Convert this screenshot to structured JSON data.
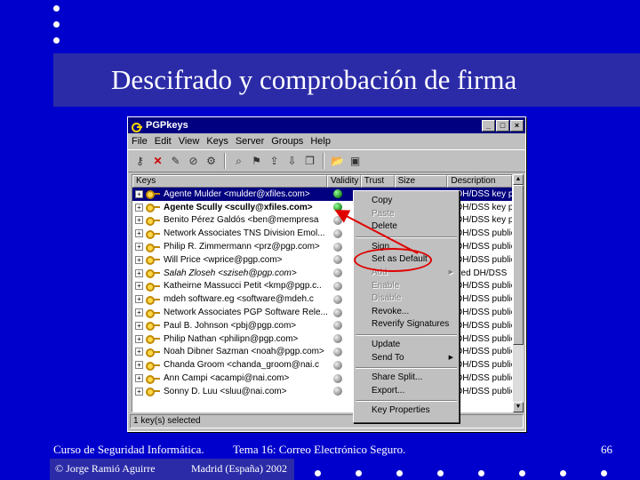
{
  "slide": {
    "title": "Descifrado y comprobación de firma",
    "footer_course": "Curso de Seguridad Informática.",
    "footer_topic": "Tema 16:  Correo Electrónico Seguro.",
    "page_number": "66",
    "author": "© Jorge Ramió Aguirre",
    "location": "Madrid (España) 2002"
  },
  "window": {
    "title": "PGPkeys",
    "menu": [
      "File",
      "Edit",
      "View",
      "Keys",
      "Server",
      "Groups",
      "Help"
    ],
    "columns": [
      "Keys",
      "Validity",
      "Trust",
      "Size",
      "Description"
    ],
    "status": "1 key(s) selected"
  },
  "keys": [
    {
      "name": "Agente Mulder <mulder@xfiles.com>",
      "desc": "DH/DSS key p",
      "validity": "green",
      "style": "sel"
    },
    {
      "name": "Agente Scully <scully@xfiles.com>",
      "desc": "DH/DSS key p",
      "validity": "green",
      "style": "bold"
    },
    {
      "name": "Benito Pérez Galdós <ben@mempresa",
      "desc": "DH/DSS key p",
      "validity": "gray",
      "style": ""
    },
    {
      "name": "Network Associates TNS Division Emol...",
      "desc": "DH/DSS public",
      "validity": "gray",
      "style": ""
    },
    {
      "name": "Philip R. Zimmermann <prz@pgp.com>",
      "desc": "DH/DSS public",
      "validity": "gray",
      "style": ""
    },
    {
      "name": "Will Price <wprice@pgp.com>",
      "desc": "DH/DSS public",
      "validity": "gray",
      "style": ""
    },
    {
      "name": "Salah Zloseh <sziseh@pgp.com>",
      "desc": "ired DH/DSS",
      "validity": "gray",
      "style": "ital"
    },
    {
      "name": "Katheirne Massucci Petit <kmp@pgp.c..",
      "desc": "DH/DSS public",
      "validity": "gray",
      "style": ""
    },
    {
      "name": "mdeh software.eg <software@mdeh.c",
      "desc": "DH/DSS public",
      "validity": "gray",
      "style": ""
    },
    {
      "name": "Network Associates PGP Software Rele...",
      "desc": "DH/DSS public",
      "validity": "gray",
      "style": ""
    },
    {
      "name": "Paul B. Johnson <pbj@pgp.com>",
      "desc": "DH/DSS public",
      "validity": "gray",
      "style": ""
    },
    {
      "name": "Philip Nathan <philipn@pgp.com>",
      "desc": "DH/DSS public",
      "validity": "gray",
      "style": ""
    },
    {
      "name": "Noah Dibner Sazman <noah@pgp.com>",
      "desc": "DH/DSS public",
      "validity": "gray",
      "style": ""
    },
    {
      "name": "Chanda Groom <chanda_groom@nai.c",
      "desc": "DH/DSS public",
      "validity": "gray",
      "style": ""
    },
    {
      "name": "Ann Campi <acampi@nai.com>",
      "desc": "DH/DSS public",
      "validity": "gray",
      "style": ""
    },
    {
      "name": "Sonny D. Luu <sluu@nai.com>",
      "desc": "DH/DSS public",
      "validity": "gray",
      "style": ""
    }
  ],
  "context_menu": [
    {
      "label": "Copy",
      "disabled": false,
      "submenu": false
    },
    {
      "label": "Paste",
      "disabled": true,
      "submenu": false
    },
    {
      "label": "Delete",
      "disabled": false,
      "submenu": false
    },
    {
      "sep": true
    },
    {
      "label": "Sign...",
      "disabled": false,
      "submenu": false
    },
    {
      "label": "Set as Default",
      "disabled": false,
      "submenu": false
    },
    {
      "label": "Add",
      "disabled": true,
      "submenu": true
    },
    {
      "label": "Enable",
      "disabled": true,
      "submenu": false
    },
    {
      "label": "Disable",
      "disabled": true,
      "submenu": false
    },
    {
      "label": "Revoke...",
      "disabled": false,
      "submenu": false
    },
    {
      "label": "Reverify Signatures",
      "disabled": false,
      "submenu": false
    },
    {
      "sep": true
    },
    {
      "label": "Update",
      "disabled": false,
      "submenu": false
    },
    {
      "label": "Send To",
      "disabled": false,
      "submenu": true
    },
    {
      "sep": true
    },
    {
      "label": "Share Split...",
      "disabled": false,
      "submenu": false
    },
    {
      "label": "Export...",
      "disabled": false,
      "submenu": false
    },
    {
      "sep": true
    },
    {
      "label": "Key Properties",
      "disabled": false,
      "submenu": false
    }
  ],
  "colors": {
    "background": "#0000cc",
    "band": "#2b2ba8",
    "selection": "#000080",
    "annotation": "#e00000"
  }
}
